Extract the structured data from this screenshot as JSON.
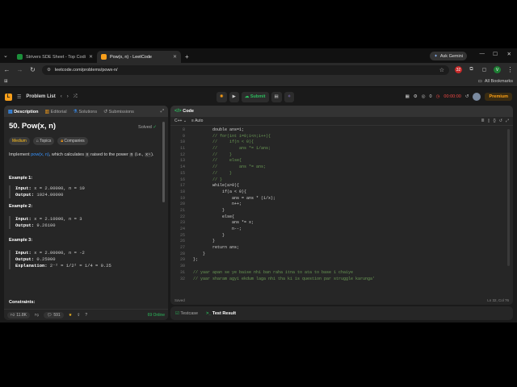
{
  "browser": {
    "tabs": [
      {
        "title": "Strivers SDE Sheet - Top Codin…",
        "active": false,
        "favicon_color": "#1b8f3a"
      },
      {
        "title": "Pow(x, n) - LeetCode",
        "active": true,
        "favicon_color": "#f89f1b"
      }
    ],
    "new_tab": "+",
    "ask_gemini": "Ask Gemini",
    "url": "leetcode.com/problems/powx-n/",
    "bookmarks_label": "All Bookmarks",
    "extension_badge": "32",
    "profile_initial": "V"
  },
  "leetcode_nav": {
    "problem_list": "Problem List",
    "submit": "Submit",
    "timer": "00:00:00",
    "coins": "0",
    "premium": "Premium"
  },
  "left_panel": {
    "tabs": [
      "Description",
      "Editorial",
      "Solutions",
      "Submissions"
    ],
    "title": "50. Pow(x, n)",
    "status": "Solved",
    "difficulty": "Medium",
    "topics": "Topics",
    "companies": "Companies",
    "statement": {
      "pre": "Implement ",
      "link": "pow(x, n)",
      "mid": ", which calculates ",
      "x": "x",
      "mid2": " raised to the power ",
      "n": "n",
      "post": " (i.e., ",
      "xn": "xⁿ",
      "end": ")."
    },
    "examples": [
      {
        "heading": "Example 1:",
        "input": "x = 2.00000, n = 10",
        "output": "1024.00000",
        "explanation": ""
      },
      {
        "heading": "Example 2:",
        "input": "x = 2.10000, n = 3",
        "output": "9.26100",
        "explanation": ""
      },
      {
        "heading": "Example 3:",
        "input": "x = 2.00000, n = -2",
        "output": "0.25000",
        "explanation": "2⁻² = 1/2² = 1/4 = 0.25"
      }
    ],
    "input_label": "Input:",
    "output_label": "Output:",
    "explanation_label": "Explanation:",
    "constraints": "Constraints:",
    "footer": {
      "likes": "11.8K",
      "comments": "591",
      "online": "69 Online"
    }
  },
  "code_panel": {
    "tab": "Code",
    "language": "C++",
    "auto": "Auto",
    "lines": [
      {
        "n": "8",
        "text": "        double ans=1;"
      },
      {
        "n": "9",
        "text": "        // for(int i=0;i<n;i++){"
      },
      {
        "n": "10",
        "text": "        //     if(n < 0){"
      },
      {
        "n": "11",
        "text": "        //         ans *= 1/ans;"
      },
      {
        "n": "12",
        "text": "        //     }"
      },
      {
        "n": "13",
        "text": "        //     else{"
      },
      {
        "n": "14",
        "text": "        //         ans *= ans;"
      },
      {
        "n": "15",
        "text": "        //     }"
      },
      {
        "n": "16",
        "text": "        // }"
      },
      {
        "n": "17",
        "text": "        while(a>0){"
      },
      {
        "n": "18",
        "text": "            if(a < 0){"
      },
      {
        "n": "19",
        "text": "                ans = ans * (1/x);"
      },
      {
        "n": "20",
        "text": "                n++;"
      },
      {
        "n": "21",
        "text": "            }"
      },
      {
        "n": "22",
        "text": "            else{"
      },
      {
        "n": "23",
        "text": "                ans *= x;"
      },
      {
        "n": "24",
        "text": "                n--;"
      },
      {
        "n": "25",
        "text": "            }"
      },
      {
        "n": "26",
        "text": "        }"
      },
      {
        "n": "27",
        "text": "        return ans;"
      },
      {
        "n": "28",
        "text": "    }"
      },
      {
        "n": "29",
        "text": "};"
      },
      {
        "n": "30",
        "text": ""
      },
      {
        "n": "31",
        "text": "// yaar apan se ye baise nhi ban raha itna to ata to base 1 chaiye"
      },
      {
        "n": "32",
        "text": "// yaar sharam agyi ekdum laga nhi tha ki is question par struggle karunga'"
      }
    ],
    "saved": "Saved",
    "cursor": "Ln 32, Col 76"
  },
  "bottom_panel": {
    "tabs": [
      "Testcase",
      "Test Result"
    ]
  }
}
